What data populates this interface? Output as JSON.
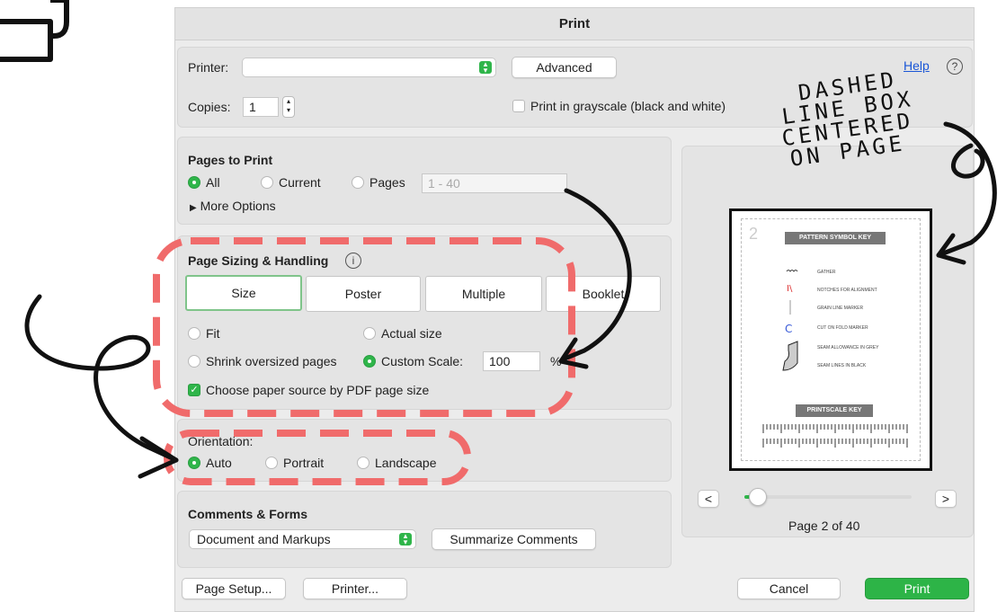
{
  "dialog": {
    "title": "Print"
  },
  "printer": {
    "label": "Printer:",
    "value": "",
    "advanced_label": "Advanced",
    "help_label": "Help",
    "help_icon": "?"
  },
  "copies": {
    "label": "Copies:",
    "value": "1"
  },
  "grayscale": {
    "label": "Print in grayscale (black and white)",
    "checked": false
  },
  "pages_to_print": {
    "title": "Pages to Print",
    "all_label": "All",
    "current_label": "Current",
    "pages_label": "Pages",
    "pages_placeholder": "1 - 40",
    "more_options_label": "More Options",
    "selected": "All"
  },
  "sizing": {
    "title": "Page Sizing & Handling",
    "info_icon": "i",
    "tabs": [
      "Size",
      "Poster",
      "Multiple",
      "Booklet"
    ],
    "selected_tab": "Size",
    "fit_label": "Fit",
    "actual_label": "Actual size",
    "shrink_label": "Shrink oversized pages",
    "custom_label": "Custom Scale:",
    "custom_value": "100",
    "percent": "%",
    "selected": "Custom Scale",
    "paper_source_label": "Choose paper source by PDF page size",
    "paper_source_checked": true
  },
  "orientation": {
    "label": "Orientation:",
    "auto_label": "Auto",
    "portrait_label": "Portrait",
    "landscape_label": "Landscape",
    "selected": "Auto"
  },
  "comments": {
    "title": "Comments & Forms",
    "value": "Document and Markups",
    "summarize_label": "Summarize Comments"
  },
  "preview": {
    "prev_label": "<",
    "next_label": ">",
    "page_indicator": "Page 2 of 40",
    "page_number": "2",
    "symbol_key_title": "PATTERN SYMBOL KEY",
    "symbol_rows": [
      "GATHER",
      "NOTCHES FOR ALIGNMENT",
      "GRAIN LINE MARKER",
      "CUT ON FOLD MARKER",
      "SEAM ALLOWANCE IN GREY",
      "SEAM LINES IN BLACK"
    ],
    "scale_key_title": "PRINTSCALE KEY"
  },
  "footer": {
    "page_setup_label": "Page Setup...",
    "printer_label": "Printer...",
    "cancel_label": "Cancel",
    "print_label": "Print"
  },
  "annotation": {
    "lines": [
      "DASHED",
      "LINE BOX",
      "CENTERED",
      "ON PAGE"
    ]
  },
  "colors": {
    "accent_green": "#2fb54a",
    "highlight_red": "#f06b6b",
    "link_blue": "#1a56d6"
  }
}
